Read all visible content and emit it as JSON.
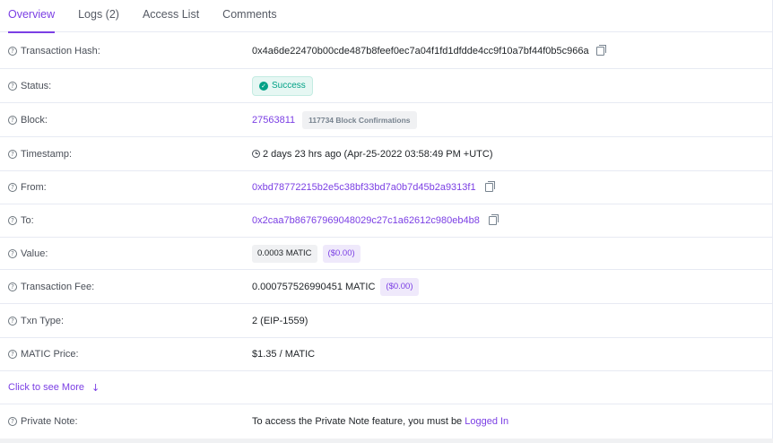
{
  "tabs": [
    "Overview",
    "Logs (2)",
    "Access List",
    "Comments"
  ],
  "rows": {
    "tx_hash": {
      "label": "Transaction Hash:",
      "value": "0x4a6de22470b00cde487b8feef0ec7a04f1fd1dfdde4cc9f10a7bf44f0b5c966a"
    },
    "status": {
      "label": "Status:",
      "value": "Success"
    },
    "block": {
      "label": "Block:",
      "value": "27563811",
      "confirmations": "117734 Block Confirmations"
    },
    "timestamp": {
      "label": "Timestamp:",
      "value": "2 days 23 hrs ago (Apr-25-2022 03:58:49 PM +UTC)"
    },
    "from": {
      "label": "From:",
      "value": "0xbd78772215b2e5c38bf33bd7a0b7d45b2a9313f1"
    },
    "to": {
      "label": "To:",
      "value": "0x2caa7b86767969048029c27c1a62612c980eb4b8"
    },
    "value": {
      "label": "Value:",
      "amount": "0.0003 MATIC",
      "usd": "($0.00)"
    },
    "fee": {
      "label": "Transaction Fee:",
      "amount": "0.000757526990451 MATIC",
      "usd": "($0.00)"
    },
    "txn_type": {
      "label": "Txn Type:",
      "value": "2 (EIP-1559)"
    },
    "price": {
      "label": "MATIC Price:",
      "value": "$1.35 / MATIC"
    },
    "note": {
      "label": "Private Note:",
      "text": "To access the Private Note feature, you must be ",
      "link": "Logged In"
    }
  },
  "see_more": "Click to see More",
  "colors": {
    "accent": "#7b3fe4",
    "success": "#00a186",
    "border": "#e7eaf3"
  }
}
